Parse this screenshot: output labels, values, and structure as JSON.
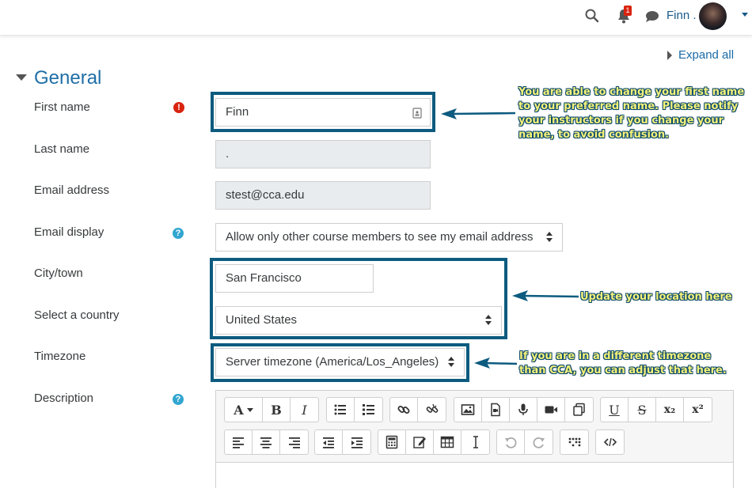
{
  "navbar": {
    "username": "Finn .",
    "notification_count": "1"
  },
  "expand_all": "Expand all",
  "section": {
    "title": "General"
  },
  "fields": {
    "first_name": {
      "label": "First name",
      "value": "Finn"
    },
    "last_name": {
      "label": "Last name",
      "value": "."
    },
    "email": {
      "label": "Email address",
      "value": "stest@cca.edu"
    },
    "email_display": {
      "label": "Email display",
      "value": "Allow only other course members to see my email address"
    },
    "city": {
      "label": "City/town",
      "value": "San Francisco"
    },
    "country": {
      "label": "Select a country",
      "value": "United States"
    },
    "timezone": {
      "label": "Timezone",
      "value": "Server timezone (America/Los_Angeles)"
    },
    "description": {
      "label": "Description"
    }
  },
  "callouts": {
    "name": "You are able to change your first name to your preferred name. Please notify your instructors if you change your name, to avoid confusion.",
    "location": "Update your location here",
    "timezone": "If you are in a different timezone than CCA, you can adjust that here."
  },
  "editor": {
    "font_label": "A",
    "bold": "B",
    "italic": "I",
    "underline": "U",
    "strike": "S",
    "subscript": "x₂",
    "superscript": "x²"
  },
  "colors": {
    "accent": "#1f6ea7",
    "highlight_border": "#0d5b7f",
    "callout_text": "#f6f27a",
    "required": "#d9230f",
    "help": "#32a6d0"
  }
}
